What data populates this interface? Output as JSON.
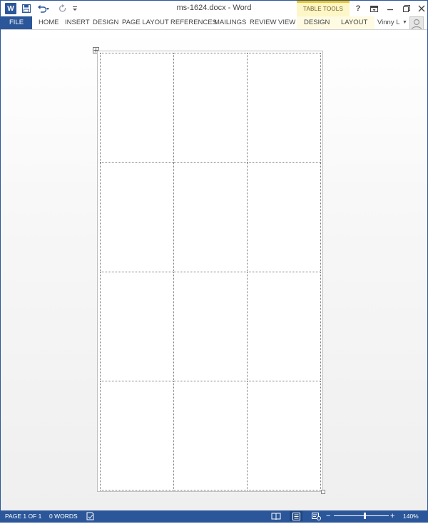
{
  "titlebar": {
    "app_icon": "word-icon",
    "app_icon_letter": "W",
    "document_title": "ms-1624.docx - Word",
    "context_group_label": "TABLE TOOLS",
    "help_label": "?"
  },
  "ribbon": {
    "tabs": [
      {
        "label": "FILE"
      },
      {
        "label": "HOME"
      },
      {
        "label": "INSERT"
      },
      {
        "label": "DESIGN"
      },
      {
        "label": "PAGE LAYOUT"
      },
      {
        "label": "REFERENCES"
      },
      {
        "label": "MAILINGS"
      },
      {
        "label": "REVIEW"
      },
      {
        "label": "VIEW"
      }
    ],
    "context_tabs": [
      {
        "label": "DESIGN"
      },
      {
        "label": "LAYOUT"
      }
    ],
    "user_name": "Vinny L"
  },
  "document": {
    "table": {
      "rows": 4,
      "columns": 3
    }
  },
  "statusbar": {
    "page": "PAGE 1 OF 1",
    "words": "0 WORDS",
    "zoom": "140%",
    "zoom_percent": 140
  },
  "colors": {
    "accent": "#2b579a",
    "context_tab": "#f0c520"
  }
}
